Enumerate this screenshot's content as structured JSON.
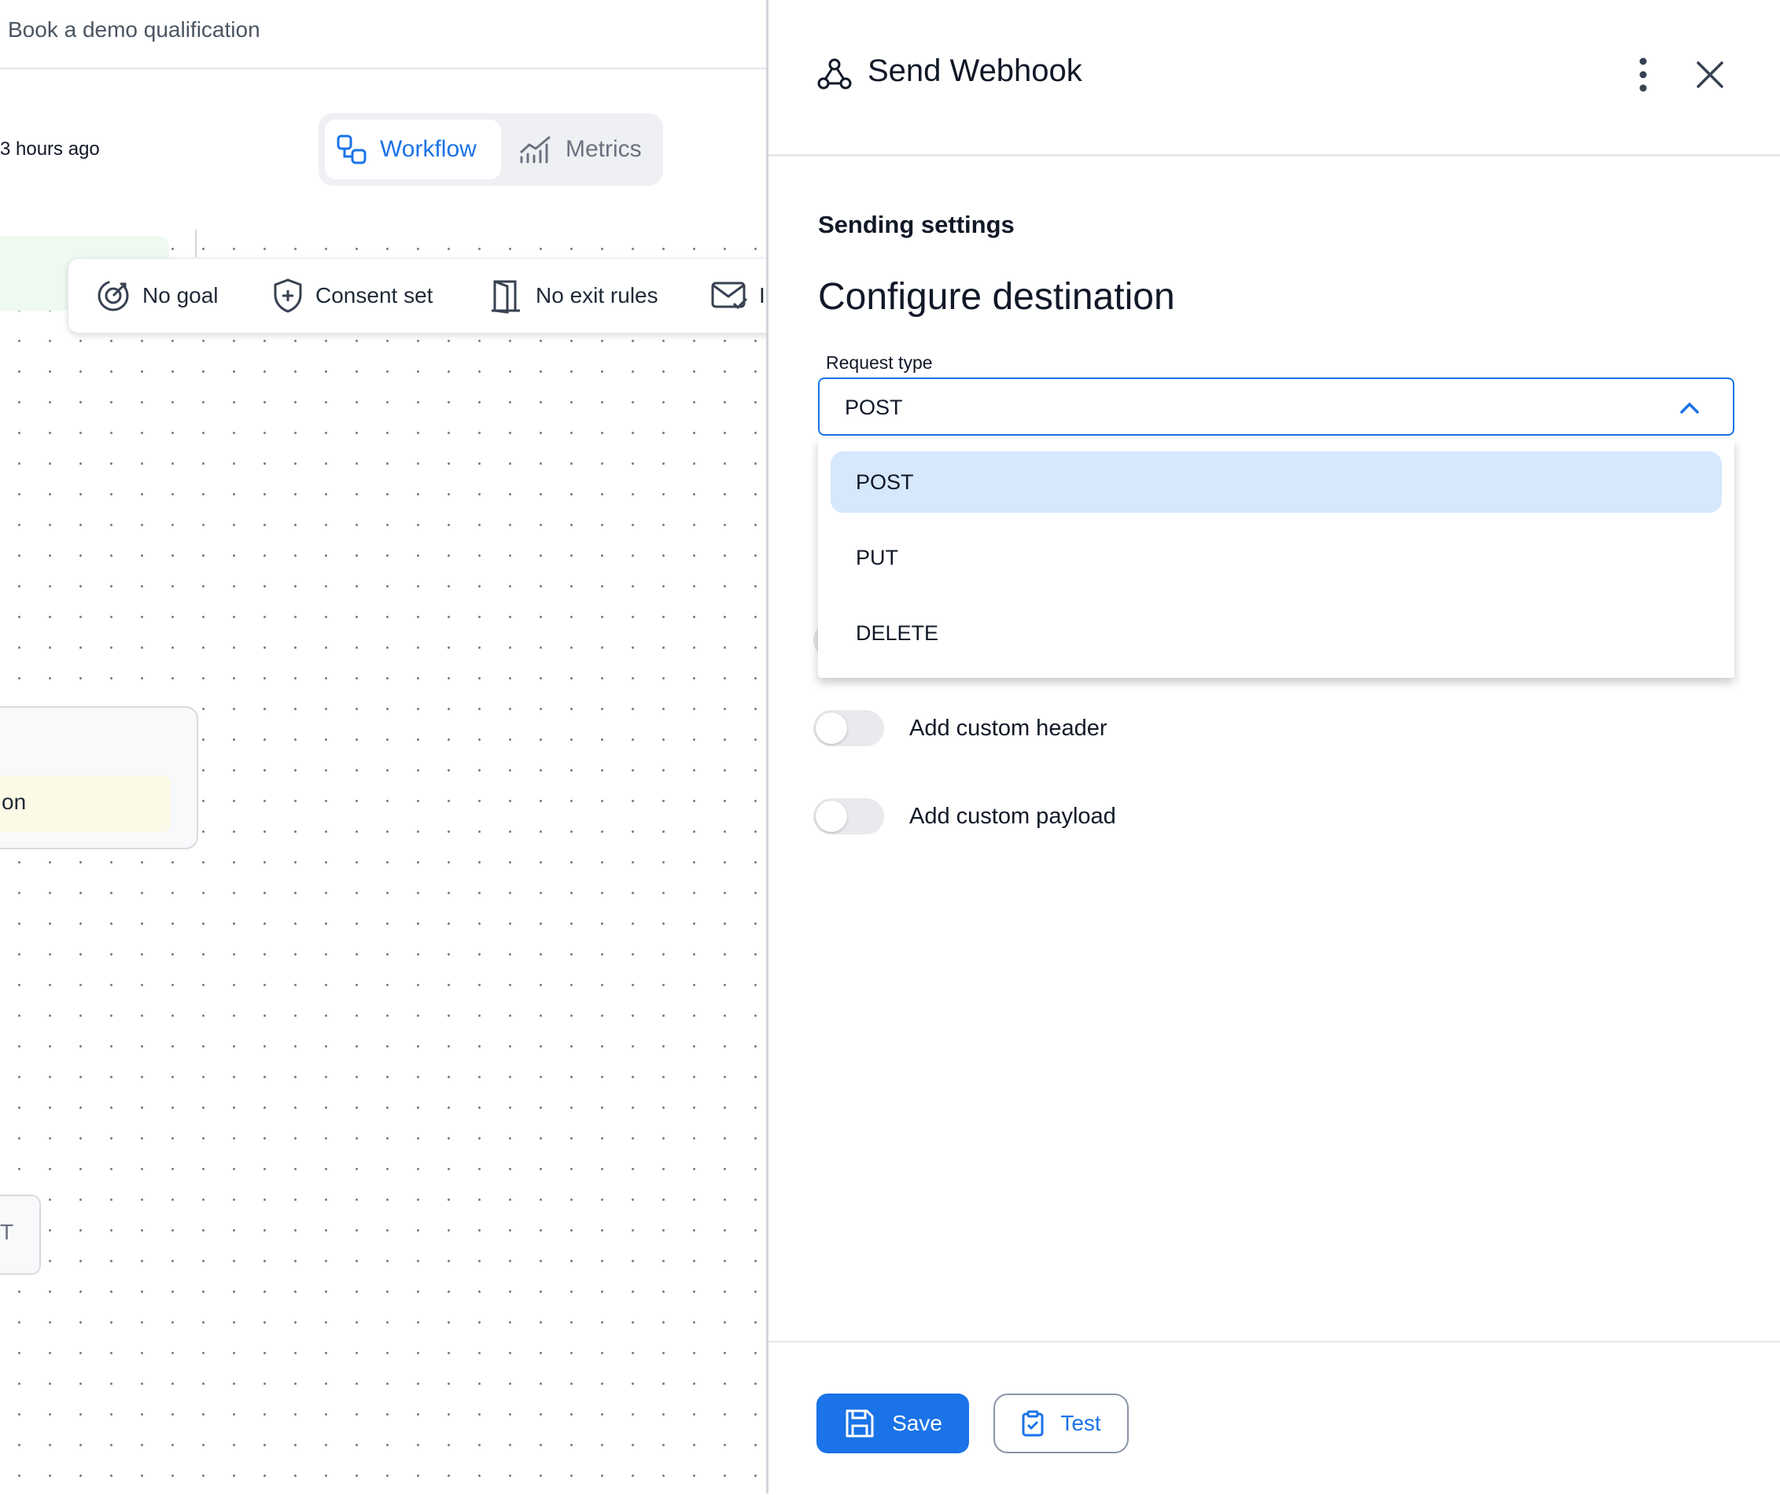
{
  "workflow": {
    "name": "Book a demo qualification",
    "last_saved": "3 hours ago"
  },
  "view_switch": {
    "workflow_label": "Workflow",
    "metrics_label": "Metrics",
    "active": "Workflow"
  },
  "settings_bar": {
    "goal_label": "No goal",
    "consent_label": "Consent set",
    "exit_rules_label": "No exit rules",
    "email_label": "I"
  },
  "canvas": {
    "node_a_text": "on",
    "node_b_text": "T"
  },
  "panel": {
    "title": "Send Webhook",
    "icon": "webhook-icon",
    "section_title": "Sending settings",
    "heading": "Configure destination",
    "request_type": {
      "label": "Request type",
      "value": "POST",
      "options": [
        "POST",
        "PUT",
        "DELETE"
      ],
      "selected": "POST"
    },
    "toggles": [
      {
        "label": "Add custom header",
        "on": false
      },
      {
        "label": "Add custom payload",
        "on": false
      }
    ],
    "footer": {
      "save_label": "Save",
      "test_label": "Test"
    }
  },
  "colors": {
    "accent": "#1a73e8",
    "selected_option_bg": "#d5e8fc",
    "toggle_off": "#e8eaed"
  }
}
